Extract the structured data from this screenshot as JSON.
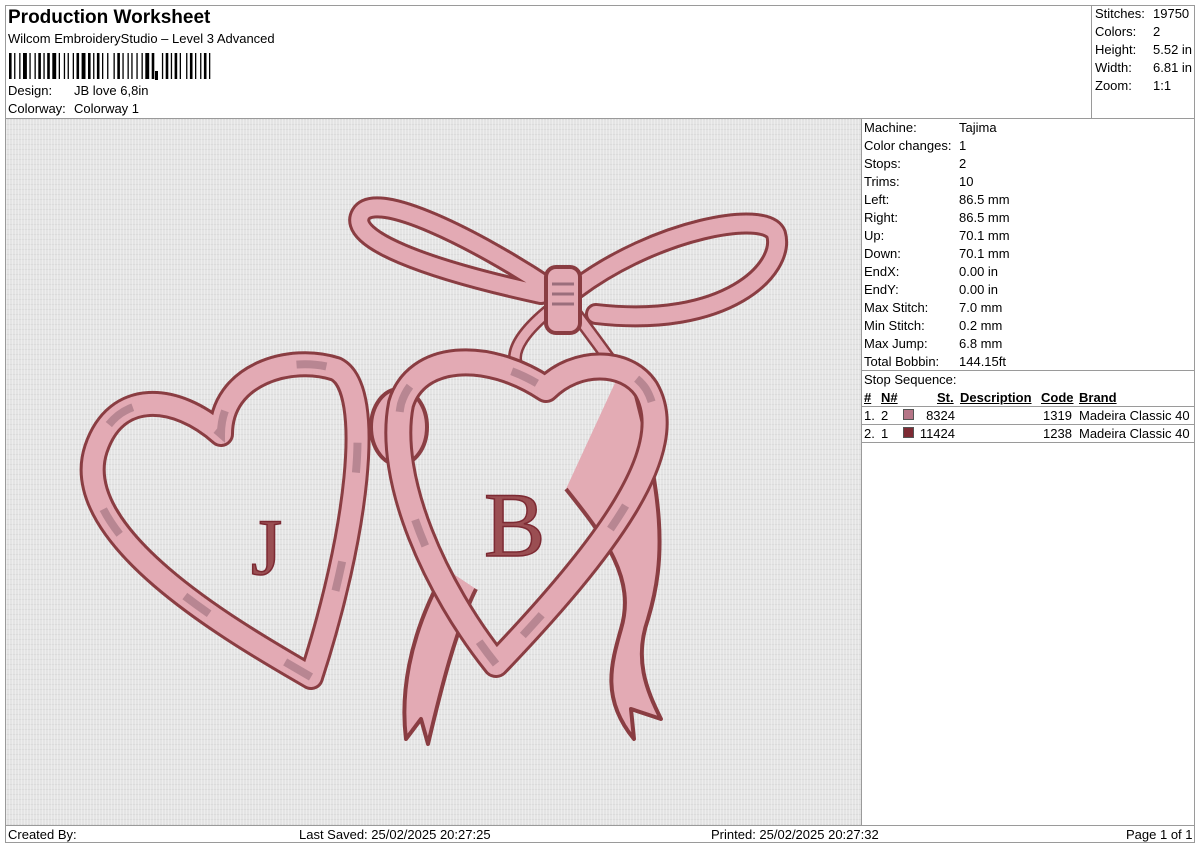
{
  "header": {
    "title": "Production Worksheet",
    "subtitle": "Wilcom EmbroideryStudio – Level 3 Advanced",
    "design_label": "Design:",
    "design_value": "JB love 6,8in",
    "colorway_label": "Colorway:",
    "colorway_value": "Colorway 1"
  },
  "stats": [
    {
      "label": "Stitches:",
      "value": "19750"
    },
    {
      "label": "Colors:",
      "value": "2"
    },
    {
      "label": "Height:",
      "value": "5.52 in"
    },
    {
      "label": "Width:",
      "value": "6.81 in"
    },
    {
      "label": "Zoom:",
      "value": "1:1"
    }
  ],
  "machine": [
    {
      "label": "Machine:",
      "value": "Tajima"
    },
    {
      "label": "Color changes:",
      "value": "1"
    },
    {
      "label": "Stops:",
      "value": "2"
    },
    {
      "label": "Trims:",
      "value": "10"
    },
    {
      "label": "Left:",
      "value": "86.5 mm"
    },
    {
      "label": "Right:",
      "value": "86.5 mm"
    },
    {
      "label": "Up:",
      "value": "70.1 mm"
    },
    {
      "label": "Down:",
      "value": "70.1 mm"
    },
    {
      "label": "EndX:",
      "value": "0.00 in"
    },
    {
      "label": "EndY:",
      "value": "0.00 in"
    },
    {
      "label": "Max Stitch:",
      "value": "7.0 mm"
    },
    {
      "label": "Min Stitch:",
      "value": "0.2 mm"
    },
    {
      "label": "Max Jump:",
      "value": "6.8 mm"
    },
    {
      "label": "Total Bobbin:",
      "value": "144.15ft"
    }
  ],
  "stop_sequence": {
    "title": "Stop Sequence:",
    "headers": {
      "num": "#",
      "n": "N#",
      "st": "St.",
      "desc": "Description",
      "code": "Code",
      "brand": "Brand"
    },
    "rows": [
      {
        "num": "1.",
        "n": "2",
        "color": "#b57587",
        "st": "8324",
        "desc": "",
        "code": "1319",
        "brand": "Madeira Classic 40"
      },
      {
        "num": "2.",
        "n": "1",
        "color": "#7d2a33",
        "st": "11424",
        "desc": "",
        "code": "1238",
        "brand": "Madeira Classic 40"
      }
    ]
  },
  "design": {
    "letters": [
      "J",
      "B"
    ],
    "fill_color": "#e3aab4",
    "outline_color": "#8a3d42",
    "shade_color": "#9b6e7c"
  },
  "footer": {
    "created_by": "Created By:",
    "last_saved": "Last Saved: 25/02/2025 20:27:25",
    "printed": "Printed: 25/02/2025 20:27:32",
    "page": "Page 1 of 1"
  }
}
